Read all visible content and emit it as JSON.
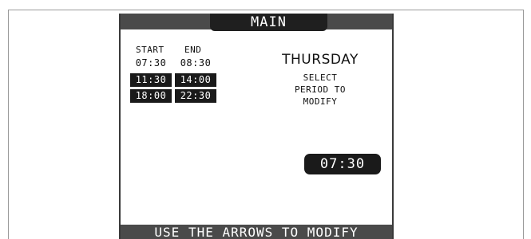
{
  "header": {
    "title": "MAIN"
  },
  "schedule": {
    "start_header": "START",
    "end_header": "END",
    "rows": [
      {
        "start": "07:30",
        "end": "08:30",
        "highlighted": false
      },
      {
        "start": "11:30",
        "end": "14:00",
        "highlighted": true
      },
      {
        "start": "18:00",
        "end": "22:30",
        "highlighted": true
      }
    ]
  },
  "day": "THURSDAY",
  "instruction": {
    "line1": "SELECT",
    "line2": "PERIOD TO",
    "line3": "MODIFY"
  },
  "current_value": "07:30",
  "footer": {
    "hint": "USE THE ARROWS TO MODIFY"
  },
  "colors": {
    "bar": "#4a4a4a",
    "tab": "#1f1f1f",
    "cell": "#1a1a1a",
    "text": "#111111"
  }
}
